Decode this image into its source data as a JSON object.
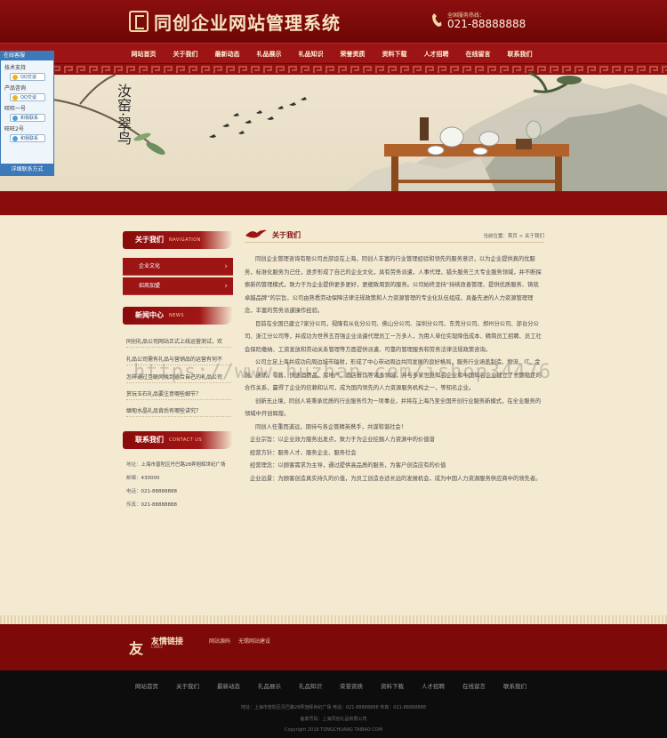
{
  "header": {
    "title": "同创企业网站管理系统",
    "phone_label": "全国服务热线：",
    "phone": "021-88888888"
  },
  "nav": [
    "网站首页",
    "关于我们",
    "最新动态",
    "礼品展示",
    "礼品知识",
    "荣誉资质",
    "资料下载",
    "人才招聘",
    "在线留言",
    "联系我们"
  ],
  "banner": {
    "calligraphy_1": "汝窑",
    "calligraphy_2": "翠鸟"
  },
  "qq": {
    "title": "在线客服",
    "groups": [
      {
        "label": "技术支持",
        "button": "QQ交谈"
      },
      {
        "label": "产品咨询",
        "button": "QQ交谈"
      },
      {
        "label": "旺旺一号",
        "button": "和我联系"
      },
      {
        "label": "旺旺2号",
        "button": "和我联系"
      }
    ],
    "footer": "详细联系方式"
  },
  "sidebar": {
    "about": {
      "title": "关于我们",
      "en": "NAVIGATION",
      "items": [
        "企业文化",
        "招商加盟"
      ]
    },
    "news": {
      "title": "新闻中心",
      "en": "NEWS",
      "items": [
        "同创礼品公司网站正式上线运营测试，欢",
        "礼品公司需有礼品与营销品的运营有何不",
        "怎样通过互联网找到适合自己的礼品公司",
        "赏玩玉石礼品要注意哪些细节？",
        "缅甸水晶礼品背后有哪些讲究？"
      ]
    },
    "contact": {
      "title": "联系我们",
      "en": "CONTACT US",
      "address_label": "地址：",
      "address": "上海市普陀区丹巴路28弄旭辉世纪广场",
      "zip_label": "邮编：",
      "zip": "430000",
      "phone_label": "电话：",
      "phone": "021-88888888",
      "fax_label": "传真：",
      "fax": "021-88888888"
    }
  },
  "main": {
    "title": "关于我们",
    "breadcrumb_label": "当前位置：",
    "breadcrumb_home": "首页",
    "breadcrumb_sep": " > ",
    "breadcrumb_current": "关于我们",
    "paragraphs": [
      "同创企业管理咨询有限公司总部设在上海，同创人丰富的行业管理经验和领先的服务意识，以为企业提供真的优服务，标准化服务为己任，逐步形成了自己的企业文化，具有劳务派遣，人事代理，猎头服务三大专业服务领域，并不断探索新的管理模式，致力于为企业提供更多更好，更细致周到的服务。公司始终坚持“持续改善管理、提供优质服务、铸就卓越品牌”的宗旨，公司由熟悉劳动保障法律法规政策和人力资源管理的专业化队伍组成，具备先进的人力资源管理理念，丰富的劳务派遣操作经验。",
      "目前在全国已建立7家分公司，视隆有从化分公司、佛山分公司、深圳分公司、东莞分公司、郑州分公司、部台分公司、浙江分公司等，并成功为世界五百强企业派遣代理员工一万多人，为用人单位实现降低成本、精简员工招聘、员工社会保险缴纳、工资发放和劳动关系管理等方面提供派遣、可靠的管理服务和劳务法律法规政策咨询。",
      "公司立足上海并成功向周边城市辐射，形成了中心带动周边共同发展的良好格局，服务行业涵盖制造、物流、IT、金融、通讯、零售、快速消费品、房地产、酒店餐饮等诸多领域，并与多家世界知名企业和中国知名企业建立了长期稳定的合作关系，赢得了企业的信赖和认可，成为国内领先的人力资源服务机构之一，等知名企业。",
      "创新无止境，同创人将秉承优质的行业服务作为一项事业，并将在上海乃至全国开创行业服务新模式，在全业服务的领域中开创辉煌。",
      "同创人任重而道远，期待与各企管精英携手，共谋和谐社会！"
    ],
    "lines": [
      "企业宗旨：以企业效力服务出发点，致力于为企业挖掘人力资源中的价值谱",
      "经营方针：服务人才、服务企业、服务社会",
      "经营理念：以顾客需求为主导，通过提供高品质的服务，为客户创造应有的价值",
      "企业远景：为顾客创造真实持久的价值，为员工创造合适长远的发展机会，成为中国人力资源服务供应商中的领先者。"
    ]
  },
  "watermark": "https://www.huzhan.com/ishop34476",
  "friend_links": {
    "char": "友",
    "title": "友情链接",
    "subtitle": "LINKS",
    "items": [
      "网站源码",
      "无锡网站建设"
    ]
  },
  "footer": {
    "nav": [
      "网站首页",
      "关于我们",
      "最新动态",
      "礼品展示",
      "礼品知识",
      "荣誉资质",
      "资料下载",
      "人才招聘",
      "在线留言",
      "联系我们"
    ],
    "address_line": "地址：上海市普陀区丹巴路28弄旭辉世纪广场  电话：021-88888888  传真：021-88888888",
    "record_line": "备案号码：上海同创礼品有限公司",
    "copyright": "Copyright 2016 TONGCHUANG TAIBAO COM"
  },
  "colors": {
    "primary": "#8b0f0f",
    "nav": "#9c1414",
    "page_bg": "#f4ead2",
    "footer": "#0d0d0d",
    "qq": "#3b79b8"
  }
}
